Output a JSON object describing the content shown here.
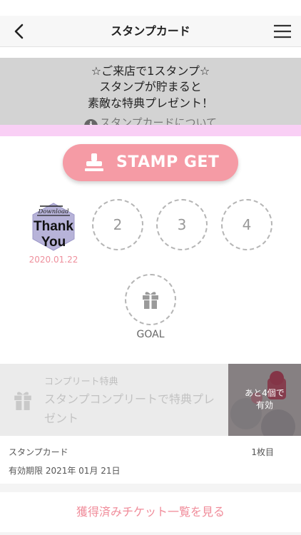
{
  "nav": {
    "title": "スタンプカード",
    "back_icon": "chevron-left-icon",
    "menu_icon": "hamburger-menu-icon"
  },
  "info": {
    "line1": "☆ご来店で1スタンプ☆",
    "line2": "スタンプが貯まると",
    "line3": "素敵な特典プレゼント！",
    "link_label": "スタンプカードについて",
    "link_icon": "info-icon"
  },
  "stamp_button": {
    "label": "STAMP GET",
    "icon": "stamp-icon"
  },
  "slots": [
    {
      "number": "",
      "stamped": true,
      "badge_small": "Download",
      "badge_line1": "Thank",
      "badge_line2": "You",
      "date": "2020.01.22"
    },
    {
      "number": "2",
      "stamped": false
    },
    {
      "number": "3",
      "stamped": false
    },
    {
      "number": "4",
      "stamped": false
    },
    {
      "number": "",
      "stamped": false,
      "icon": "gift-icon",
      "label": "GOAL"
    }
  ],
  "complete_reward": {
    "tag": "コンプリート特典",
    "text": "スタンプコンプリートで特典プレゼント",
    "icon": "gift-icon",
    "photo_line1": "あと4個で",
    "photo_line2": "有効"
  },
  "card_meta": {
    "label": "スタンプカード",
    "count": "1枚目",
    "expiry": "有効期限 2021年 01月 21日"
  },
  "ticket_link": "獲得済みチケット一覧を見る",
  "colors": {
    "accent_pink": "#f59ba5",
    "link_pink": "#f08c9a",
    "info_gray": "#d3d3d3",
    "strip_pink": "#f9cff5"
  }
}
